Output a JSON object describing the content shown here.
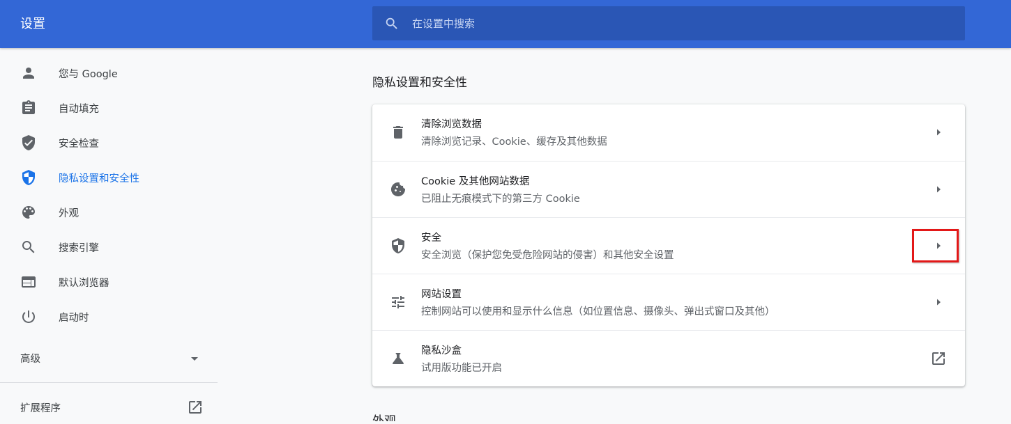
{
  "header": {
    "title": "设置",
    "search_placeholder": "在设置中搜索"
  },
  "sidebar": {
    "items": [
      {
        "label": "您与 Google",
        "icon": "person-icon"
      },
      {
        "label": "自动填充",
        "icon": "assignment-icon"
      },
      {
        "label": "安全检查",
        "icon": "shield-check-icon"
      },
      {
        "label": "隐私设置和安全性",
        "icon": "shield-half-icon",
        "active": true
      },
      {
        "label": "外观",
        "icon": "palette-icon"
      },
      {
        "label": "搜索引擎",
        "icon": "search-icon"
      },
      {
        "label": "默认浏览器",
        "icon": "browser-window-icon"
      },
      {
        "label": "启动时",
        "icon": "power-icon"
      }
    ],
    "advanced_label": "高级",
    "extensions_label": "扩展程序"
  },
  "main": {
    "section_title": "隐私设置和安全性",
    "rows": [
      {
        "title": "清除浏览数据",
        "subtitle": "清除浏览记录、Cookie、缓存及其他数据",
        "icon": "trash-icon",
        "action": "arrow-right-icon"
      },
      {
        "title": "Cookie 及其他网站数据",
        "subtitle": "已阻止无痕模式下的第三方 Cookie",
        "icon": "cookie-icon",
        "action": "arrow-right-icon"
      },
      {
        "title": "安全",
        "subtitle": "安全浏览（保护您免受危险网站的侵害）和其他安全设置",
        "icon": "shield-icon",
        "action": "arrow-right-icon"
      },
      {
        "title": "网站设置",
        "subtitle": "控制网站可以使用和显示什么信息（如位置信息、摄像头、弹出式窗口及其他）",
        "icon": "tune-icon",
        "action": "arrow-right-icon"
      },
      {
        "title": "隐私沙盒",
        "subtitle": "试用版功能已开启",
        "icon": "flask-icon",
        "action": "open-external-icon"
      }
    ],
    "next_section_title": "外观"
  },
  "colors": {
    "header_bg": "#3367d6",
    "search_bg": "#2a56b5",
    "accent": "#1a73e8",
    "highlight": "#e31818"
  }
}
